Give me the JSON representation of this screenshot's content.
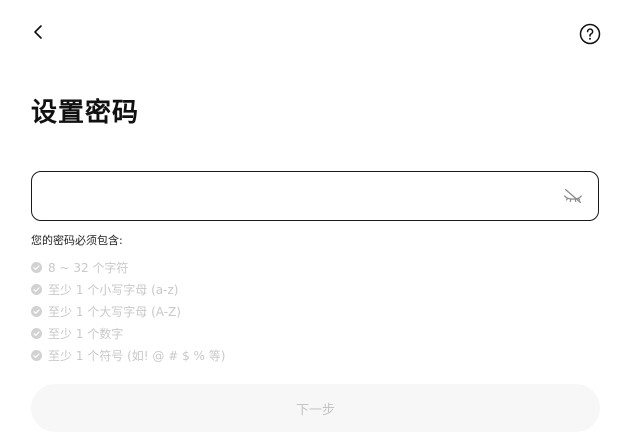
{
  "header": {
    "back_icon": "chevron-left-icon",
    "help_icon": "question-circle-icon"
  },
  "title": "设置密码",
  "password_field": {
    "value": "",
    "placeholder": "",
    "toggle_icon": "eye-slash-icon"
  },
  "requirements": {
    "heading": "您的密码必须包含:",
    "items": [
      "8 ~ 32 个字符",
      "至少 1 个小写字母 (a-z)",
      "至少 1 个大写字母 (A-Z)",
      "至少 1 个数字",
      "至少 1 个符号 (如! @ # $ % 等)"
    ],
    "check_icon": "check-circle-icon",
    "inactive_color": "#c9c9c9"
  },
  "next_button": {
    "label": "下一步",
    "background": "#f7f7f7",
    "text_color": "#c4c4c4"
  }
}
